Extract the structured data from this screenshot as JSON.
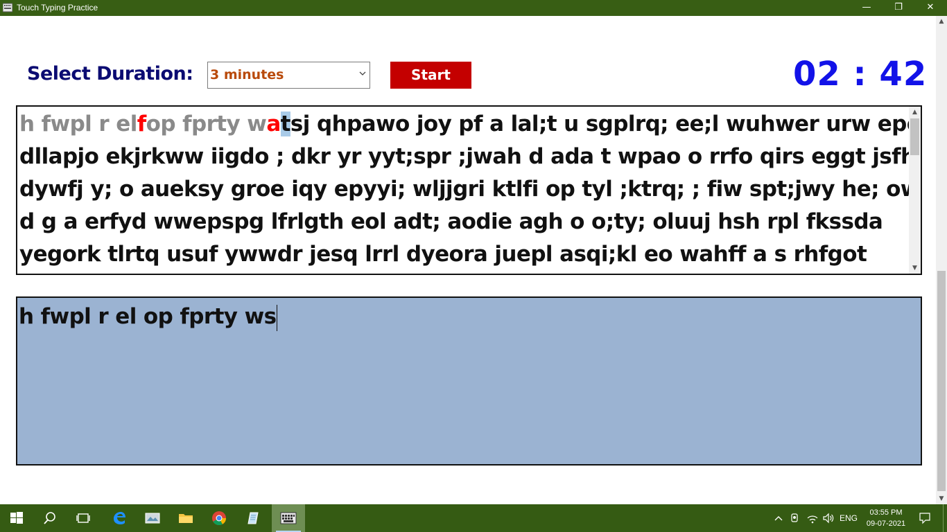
{
  "window": {
    "title": "Touch Typing Practice",
    "controls": {
      "minimize": "—",
      "maximize": "❐",
      "close": "✕"
    }
  },
  "controls": {
    "duration_label": "Select Duration:",
    "duration_selected": "3 minutes",
    "start_label": "Start",
    "timer": "02 : 42"
  },
  "passage": {
    "typed_segments": [
      {
        "text": "h fwpl r el",
        "state": "typed"
      },
      {
        "text": "f",
        "state": "error"
      },
      {
        "text": "op fprty w",
        "state": "typed"
      },
      {
        "text": "a",
        "state": "error"
      },
      {
        "text": "t",
        "state": "current"
      },
      {
        "text": "sj qhpawo joy pf a lal;t u sgplrq; ee;l wuhwer urw eperr",
        "state": "pending"
      }
    ],
    "lines": [
      "dllapjo ekjrkww iigdo ; dkr yr yyt;spr ;jwah d ada t wpao o rrfo qirs eggt jsfhas",
      "dywfj y; o aueksy groe iqy epyyi; wljjgri ktlfi op tyl ;ktrq; ; fiw spt;jwy he; owt k",
      "d g a erfyd wwepspg lfrlgth eol adt; aodie agh o o;ty; oluuj hsh rpl fkssda",
      "yegork tlrtq usuf ywwdr jesq lrrl dyeora juepl asqi;kl eo wahff a s rhfgot"
    ]
  },
  "input": {
    "value": "h fwpl r el op fprty ws"
  },
  "taskbar": {
    "apps": [
      "start",
      "search",
      "task-view",
      "edge",
      "app-1",
      "file-explorer",
      "chrome",
      "notepad",
      "typing-app"
    ],
    "tray": {
      "language": "ENG",
      "time": "03:55 PM",
      "date": "09-07-2021"
    }
  },
  "colors": {
    "titlebar": "#385e14",
    "label": "#0b0b72",
    "select_text": "#b94a0b",
    "start_button": "#c40000",
    "timer": "#1212e8",
    "typed": "#8a8a8a",
    "error": "#ff0000",
    "current_highlight": "#a9cbe8",
    "input_bg": "#9bb3d2"
  }
}
